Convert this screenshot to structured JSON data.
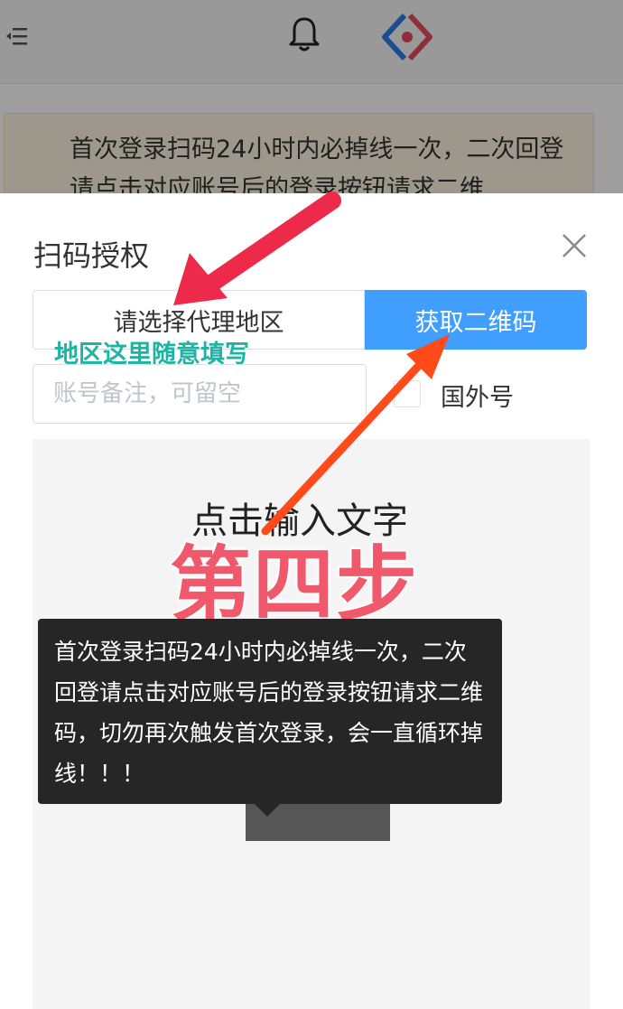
{
  "background": {
    "header": {
      "menu_icon": "menu-collapse-icon",
      "bell_icon": "bell-icon",
      "logo_icon": "diamond-logo-icon"
    },
    "notice_text": "首次登录扫码24小时内必掉线一次，二次回登请点击对应账号后的登录按钮请求二维"
  },
  "dialog": {
    "title": "扫码授权",
    "close_icon": "close-icon",
    "region_select": "请选择代理地区",
    "qr_button": "获取二维码",
    "region_hint": "地区这里随意填写",
    "remark_placeholder": "账号备注，可留空",
    "foreign_label": "国外号",
    "qr_area": {
      "text_overlay": "点击输入文字",
      "step_label": "第四步"
    },
    "tooltip": "首次登录扫码24小时内必掉线一次，二次回登请点击对应账号后的登录按钮请求二维码，切勿再次触发首次登录，会一直循环掉线！！！"
  },
  "colors": {
    "primary": "#409eff",
    "hint": "#1fb3a3",
    "annotation_red": "#ee2a4a",
    "annotation_orange": "#ff4a1a"
  }
}
